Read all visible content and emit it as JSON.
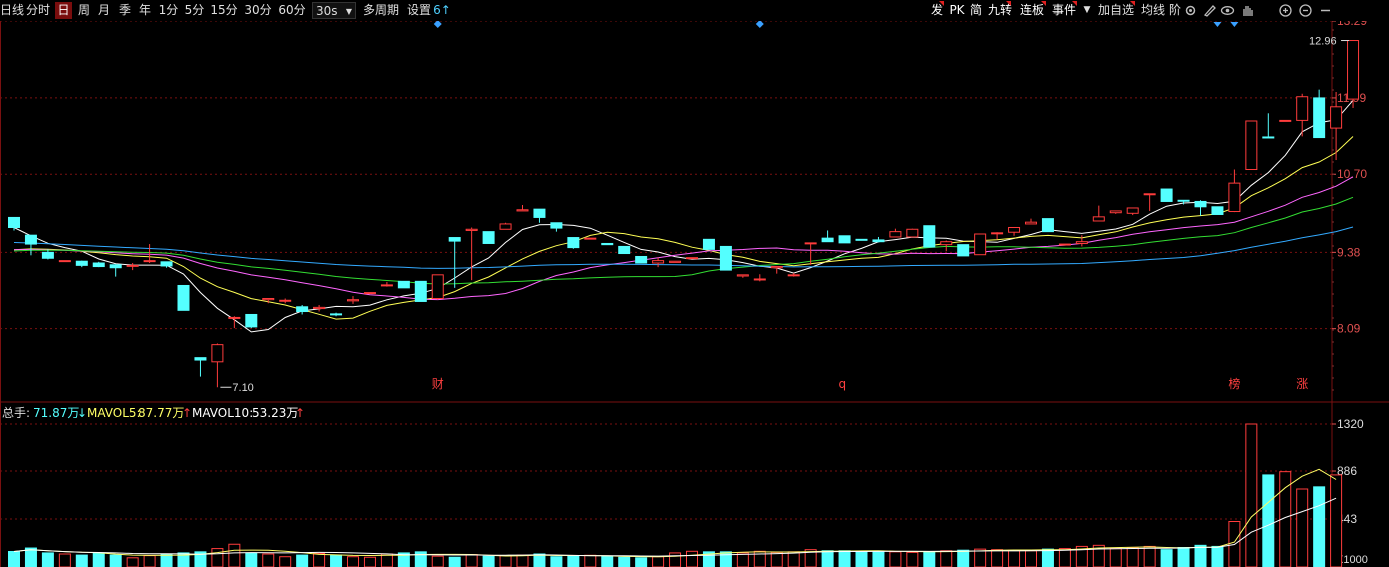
{
  "toolbar": {
    "left_cut": "日线",
    "periods": [
      "分时",
      "日",
      "周",
      "月",
      "季",
      "年",
      "1分",
      "5分",
      "15分",
      "30分",
      "60分"
    ],
    "active_period": "日",
    "step_value": "30s",
    "multi_period": "多周期",
    "settings": "设置",
    "settings_badge": "6↑",
    "right_tags": [
      "发",
      "PK",
      "简",
      "九转",
      "连板",
      "事件"
    ],
    "right_more_arrow": "▼",
    "add_favorite": "加自选",
    "avg_line": "均线",
    "cut_label": "阶"
  },
  "icons": [
    "settings-gear-icon",
    "pen-draw-icon",
    "eye-icon",
    "hand-icon",
    "zoom-in-icon",
    "zoom-out-icon",
    "collapse-icon"
  ],
  "price_axis": {
    "ticks": [
      "13.29",
      "11.99",
      "10.70",
      "9.38",
      "8.09"
    ],
    "min": 6.8,
    "max": 13.29,
    "color": "#e05050"
  },
  "markers": {
    "high_label": "12.96",
    "low_label": "7.10",
    "events": [
      {
        "text": "财",
        "index": 25,
        "color": "#ff4040"
      },
      {
        "text": "q",
        "index": 49,
        "color": "#ff4040"
      },
      {
        "text": "榜",
        "index": 72,
        "color": "#ff4040"
      },
      {
        "text": "涨",
        "index": 76,
        "color": "#ff4040"
      }
    ],
    "diamonds": [
      25,
      44
    ],
    "tri_right": [
      71,
      72
    ]
  },
  "volume_info": {
    "total_label": "总手:",
    "total_value": "71.87万",
    "total_arrow": "↓",
    "mavol5_label": "MAVOL5:",
    "mavol5_value": "87.77万",
    "mavol5_arrow": "↑",
    "mavol10_label": "MAVOL10:",
    "mavol10_value": "53.23万",
    "mavol10_arrow": "↑"
  },
  "volume_axis": {
    "ticks": [
      "1320",
      "886",
      "443"
    ],
    "unit": "X1000",
    "max": 1320
  },
  "colors": {
    "up": "#ff3c3c",
    "down": "#54ffff",
    "ma5": "#ffffff",
    "ma10": "#ffff55",
    "ma20": "#ff66ff",
    "ma30": "#33dd33",
    "ma60": "#33aaff",
    "grid": "#7a1010"
  },
  "chart_data": {
    "type": "candlestick",
    "ohlc": [
      [
        9.97,
        9.97,
        9.75,
        9.8
      ],
      [
        9.67,
        9.67,
        9.33,
        9.52
      ],
      [
        9.38,
        9.43,
        9.26,
        9.28
      ],
      [
        9.24,
        9.24,
        9.23,
        9.24
      ],
      [
        9.23,
        9.24,
        9.13,
        9.16
      ],
      [
        9.2,
        9.22,
        9.13,
        9.14
      ],
      [
        9.17,
        9.18,
        8.97,
        9.12
      ],
      [
        9.16,
        9.2,
        9.08,
        9.16
      ],
      [
        9.24,
        9.52,
        9.2,
        9.24
      ],
      [
        9.22,
        9.22,
        9.12,
        9.15
      ],
      [
        8.82,
        8.82,
        8.4,
        8.4
      ],
      [
        7.6,
        7.6,
        7.28,
        7.56
      ],
      [
        7.53,
        7.84,
        7.1,
        7.82
      ],
      [
        8.28,
        8.3,
        8.1,
        8.28
      ],
      [
        8.33,
        8.33,
        8.1,
        8.12
      ],
      [
        8.58,
        8.6,
        8.52,
        8.6
      ],
      [
        8.57,
        8.6,
        8.52,
        8.57
      ],
      [
        8.46,
        8.49,
        8.33,
        8.38
      ],
      [
        8.43,
        8.49,
        8.38,
        8.45
      ],
      [
        8.34,
        8.36,
        8.3,
        8.33
      ],
      [
        8.56,
        8.64,
        8.51,
        8.58
      ],
      [
        8.7,
        8.7,
        8.7,
        8.7
      ],
      [
        8.83,
        8.88,
        8.8,
        8.83
      ],
      [
        8.89,
        8.89,
        8.8,
        8.78
      ],
      [
        8.89,
        8.89,
        8.55,
        8.55
      ],
      [
        8.6,
        9.0,
        8.58,
        9.0
      ],
      [
        9.63,
        9.63,
        8.78,
        9.57
      ],
      [
        9.75,
        9.8,
        8.91,
        9.77
      ],
      [
        9.73,
        9.73,
        9.53,
        9.53
      ],
      [
        9.77,
        9.88,
        9.77,
        9.86
      ],
      [
        10.08,
        10.18,
        10.08,
        10.1
      ],
      [
        10.11,
        10.11,
        9.88,
        9.97
      ],
      [
        9.88,
        9.88,
        9.73,
        9.79
      ],
      [
        9.63,
        9.63,
        9.44,
        9.46
      ],
      [
        9.62,
        9.62,
        9.6,
        9.62
      ],
      [
        9.53,
        9.53,
        9.51,
        9.51
      ],
      [
        9.48,
        9.48,
        9.36,
        9.36
      ],
      [
        9.31,
        9.31,
        9.2,
        9.2
      ],
      [
        9.2,
        9.29,
        9.13,
        9.24
      ],
      [
        9.21,
        9.23,
        9.21,
        9.23
      ],
      [
        9.29,
        9.29,
        9.28,
        9.29
      ],
      [
        9.6,
        9.6,
        9.43,
        9.43
      ],
      [
        9.48,
        9.48,
        9.08,
        9.08
      ],
      [
        8.98,
        9.0,
        8.95,
        9.0
      ],
      [
        8.93,
        9.01,
        8.89,
        8.93
      ],
      [
        9.12,
        9.15,
        9.02,
        9.14
      ],
      [
        9.0,
        9.03,
        8.97,
        9.0
      ],
      [
        9.54,
        9.54,
        9.17,
        9.54
      ],
      [
        9.62,
        9.75,
        9.57,
        9.56
      ],
      [
        9.66,
        9.66,
        9.54,
        9.54
      ],
      [
        9.6,
        9.6,
        9.58,
        9.59
      ],
      [
        9.59,
        9.64,
        9.55,
        9.56
      ],
      [
        9.64,
        9.78,
        9.64,
        9.73
      ],
      [
        9.64,
        9.78,
        9.64,
        9.77
      ],
      [
        9.83,
        9.83,
        9.47,
        9.47
      ],
      [
        9.51,
        9.58,
        9.4,
        9.56
      ],
      [
        9.51,
        9.51,
        9.32,
        9.32
      ],
      [
        9.34,
        9.62,
        9.34,
        9.69
      ],
      [
        9.71,
        9.72,
        9.6,
        9.71
      ],
      [
        9.72,
        9.75,
        9.66,
        9.8
      ],
      [
        9.86,
        9.95,
        9.86,
        9.89
      ],
      [
        9.95,
        9.95,
        9.73,
        9.73
      ],
      [
        9.52,
        9.52,
        9.52,
        9.52
      ],
      [
        9.53,
        9.67,
        9.48,
        9.56
      ],
      [
        9.91,
        10.17,
        9.93,
        9.98
      ],
      [
        10.05,
        10.08,
        10.03,
        10.08
      ],
      [
        10.04,
        10.07,
        10.01,
        10.13
      ],
      [
        10.37,
        10.37,
        10.08,
        10.37
      ],
      [
        10.45,
        10.45,
        10.24,
        10.24
      ],
      [
        10.26,
        10.26,
        10.19,
        10.25
      ],
      [
        10.24,
        10.26,
        10.0,
        10.15
      ],
      [
        10.15,
        10.15,
        10.04,
        10.02
      ],
      [
        10.07,
        10.78,
        10.06,
        10.55
      ],
      [
        10.78,
        11.58,
        10.94,
        11.6
      ],
      [
        11.33,
        11.73,
        11.33,
        11.32
      ],
      [
        11.61,
        11.61,
        11.61,
        11.61
      ],
      [
        11.61,
        12.06,
        11.34,
        12.01
      ],
      [
        11.99,
        12.13,
        11.93,
        11.32
      ],
      [
        11.48,
        12.09,
        10.94,
        11.84
      ],
      [
        11.97,
        12.96,
        11.82,
        12.96
      ]
    ],
    "volume_k": [
      143,
      175,
      130,
      120,
      110,
      125,
      110,
      85,
      105,
      120,
      130,
      140,
      170,
      210,
      130,
      120,
      95,
      110,
      125,
      110,
      95,
      90,
      120,
      130,
      140,
      100,
      90,
      115,
      100,
      105,
      110,
      120,
      95,
      100,
      108,
      98,
      90,
      85,
      95,
      130,
      145,
      140,
      140,
      130,
      145,
      135,
      140,
      160,
      150,
      150,
      145,
      145,
      140,
      135,
      140,
      150,
      155,
      165,
      160,
      155,
      150,
      165,
      170,
      190,
      200,
      170,
      180,
      190,
      160,
      180,
      200,
      190,
      420,
      1320,
      850,
      880,
      720,
      740,
      850
    ]
  }
}
